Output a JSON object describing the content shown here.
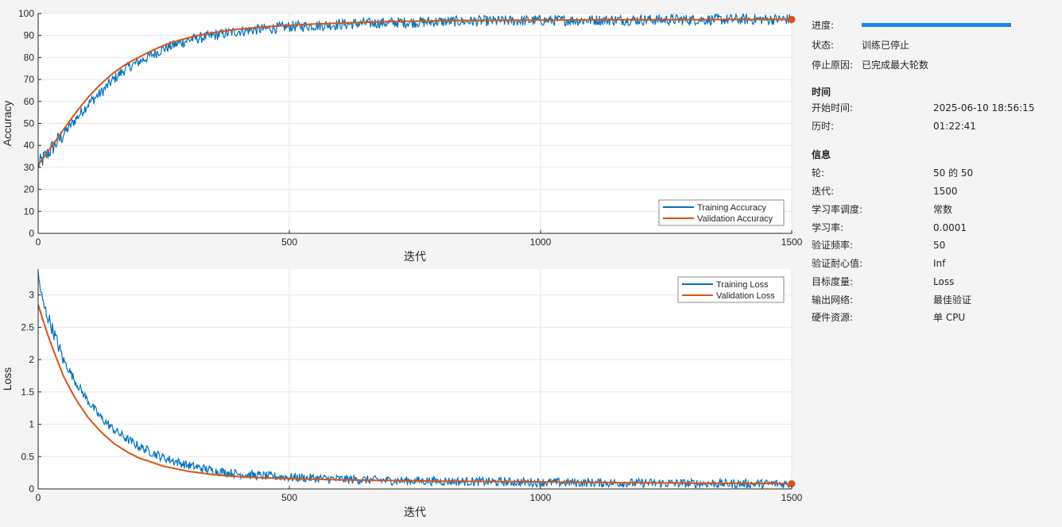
{
  "colors": {
    "training": "#0072BD",
    "validation": "#D95319",
    "grid": "#e6e6e6",
    "axis": "#262626",
    "progress": "#1e88e5"
  },
  "chart_data": [
    {
      "type": "line",
      "title": "",
      "xlabel": "迭代",
      "ylabel": "Accuracy",
      "xlim": [
        0,
        1500
      ],
      "ylim": [
        0,
        100
      ],
      "xticks": [
        "0",
        "500",
        "1000",
        "1500"
      ],
      "yticks": [
        "0",
        "10",
        "20",
        "30",
        "40",
        "50",
        "60",
        "70",
        "80",
        "90",
        "100"
      ],
      "grid": true,
      "legend": "bottom-right",
      "series": [
        {
          "name": "Training Accuracy",
          "x": [
            0,
            25,
            50,
            75,
            100,
            125,
            150,
            175,
            200,
            225,
            250,
            275,
            300,
            325,
            350,
            375,
            400,
            450,
            500,
            550,
            600,
            650,
            700,
            750,
            800,
            900,
            1000,
            1100,
            1200,
            1300,
            1400,
            1500
          ],
          "values": [
            31,
            38,
            45,
            52,
            59,
            64,
            70,
            75,
            78,
            81,
            84,
            86,
            88,
            89,
            90,
            91,
            92,
            93,
            94,
            94.5,
            95,
            95.5,
            95.8,
            96,
            96.3,
            96.6,
            96.8,
            97,
            97.1,
            97.2,
            97.3,
            97.4
          ],
          "noise": 2.5
        },
        {
          "name": "Validation Accuracy",
          "x": [
            0,
            25,
            50,
            75,
            100,
            125,
            150,
            175,
            200,
            225,
            250,
            275,
            300,
            325,
            350,
            375,
            400,
            450,
            500,
            550,
            600,
            650,
            700,
            750,
            800,
            900,
            1000,
            1100,
            1200,
            1300,
            1400,
            1500
          ],
          "values": [
            31,
            39,
            47,
            55,
            62,
            68,
            73,
            77,
            80,
            83,
            85.5,
            87.5,
            89,
            90.3,
            91.3,
            92.2,
            92.9,
            93.9,
            94.6,
            95.2,
            95.6,
            96,
            96.3,
            96.5,
            96.7,
            96.9,
            97,
            97.1,
            97.2,
            97.2,
            97.3,
            97.3
          ]
        }
      ]
    },
    {
      "type": "line",
      "title": "",
      "xlabel": "迭代",
      "ylabel": "Loss",
      "xlim": [
        0,
        1500
      ],
      "ylim": [
        0,
        3.4
      ],
      "xticks": [
        "0",
        "500",
        "1000",
        "1500"
      ],
      "yticks": [
        "0",
        "0.5",
        "1",
        "1.5",
        "2",
        "2.5",
        "3"
      ],
      "grid": true,
      "legend": "top-right",
      "series": [
        {
          "name": "Training Loss",
          "x": [
            0,
            10,
            25,
            50,
            75,
            100,
            125,
            150,
            175,
            200,
            250,
            300,
            350,
            400,
            450,
            500,
            600,
            700,
            800,
            900,
            1000,
            1100,
            1200,
            1300,
            1400,
            1500
          ],
          "values": [
            3.3,
            2.85,
            2.55,
            2.0,
            1.65,
            1.35,
            1.1,
            0.92,
            0.78,
            0.66,
            0.48,
            0.36,
            0.28,
            0.23,
            0.2,
            0.18,
            0.15,
            0.13,
            0.12,
            0.11,
            0.1,
            0.095,
            0.09,
            0.085,
            0.08,
            0.08
          ],
          "noise": 0.07
        },
        {
          "name": "Validation Loss",
          "x": [
            0,
            10,
            25,
            50,
            75,
            100,
            125,
            150,
            175,
            200,
            250,
            300,
            350,
            400,
            450,
            500,
            600,
            700,
            800,
            900,
            1000,
            1100,
            1200,
            1300,
            1400,
            1500
          ],
          "values": [
            2.85,
            2.6,
            2.25,
            1.75,
            1.38,
            1.1,
            0.88,
            0.71,
            0.58,
            0.48,
            0.35,
            0.27,
            0.22,
            0.19,
            0.17,
            0.16,
            0.14,
            0.13,
            0.12,
            0.115,
            0.11,
            0.1,
            0.095,
            0.09,
            0.085,
            0.08
          ]
        }
      ]
    }
  ],
  "info": {
    "progress_label": "进度:",
    "progress_value": 1.0,
    "status_label": "状态:",
    "status_value": "训练已停止",
    "stop_reason_label": "停止原因:",
    "stop_reason_value": "已完成最大轮数",
    "time_section": "时间",
    "start_time_label": "开始时间:",
    "start_time_value": "2025-06-10 18:56:15",
    "elapsed_label": "历时:",
    "elapsed_value": "01:22:41",
    "info_section": "信息",
    "rows": [
      {
        "label": "轮:",
        "value": "50 的 50"
      },
      {
        "label": "迭代:",
        "value": "1500"
      },
      {
        "label": "学习率调度:",
        "value": "常数"
      },
      {
        "label": "学习率:",
        "value": "0.0001"
      },
      {
        "label": "验证频率:",
        "value": "50"
      },
      {
        "label": "验证耐心值:",
        "value": "Inf"
      },
      {
        "label": "目标度量:",
        "value": "Loss"
      },
      {
        "label": "输出网络:",
        "value": "最佳验证"
      },
      {
        "label": "硬件资源:",
        "value": "单 CPU"
      }
    ]
  }
}
